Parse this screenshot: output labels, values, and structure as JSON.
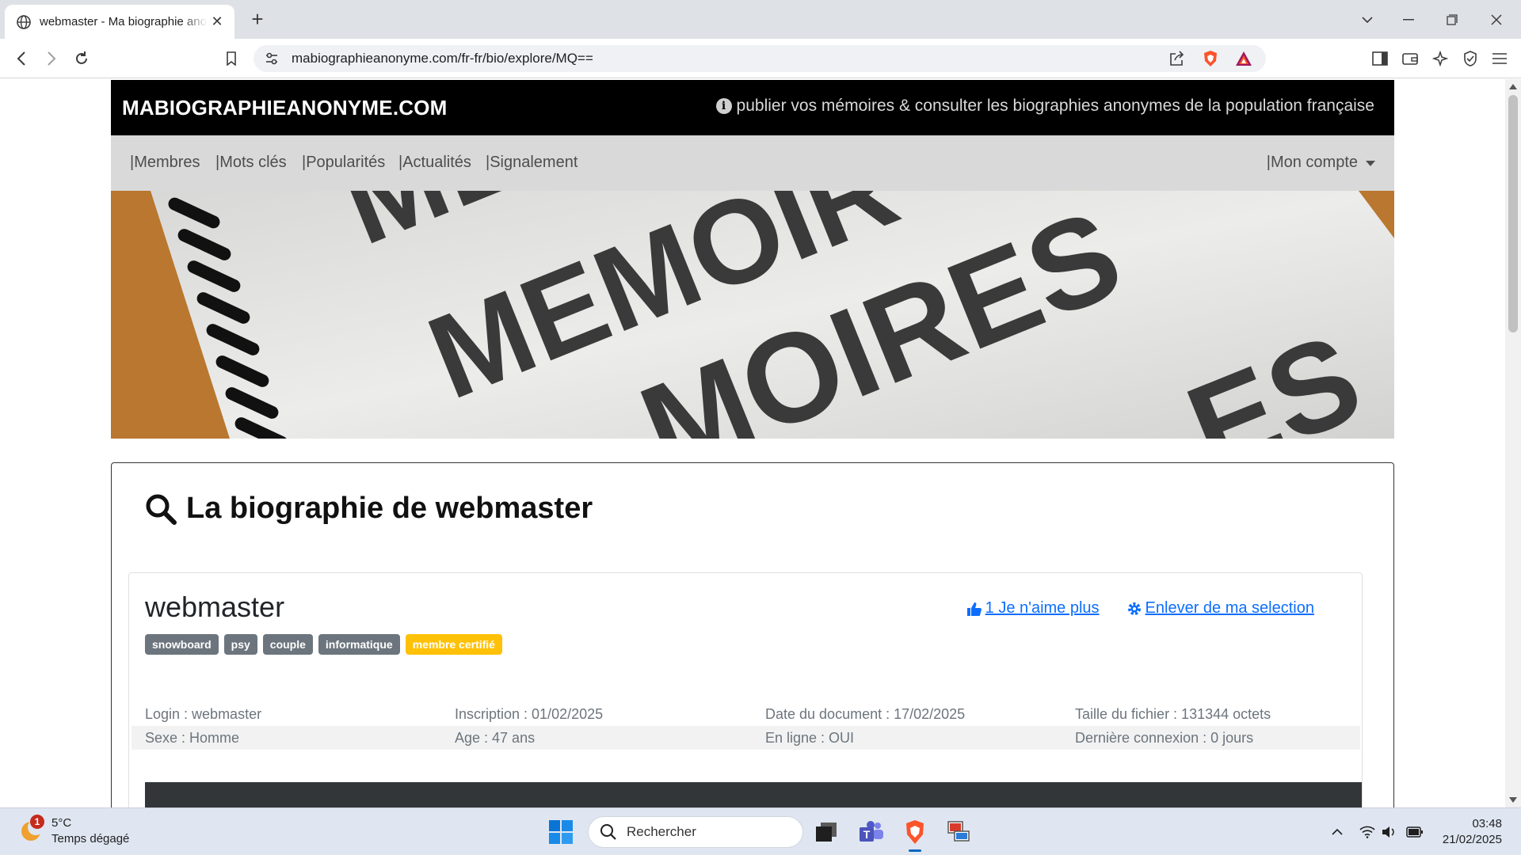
{
  "browser": {
    "tab_title": "webmaster - Ma biographie anonyme",
    "url": "mabiographieanonyme.com/fr-fr/bio/explore/MQ=="
  },
  "site": {
    "brand": "MABIOGRAPHIEANONYME.COM",
    "tagline": "publier vos mémoires & consulter les biographies anonymes de la population française",
    "nav": [
      "|Membres",
      "|Mots clés",
      "|Popularités",
      "|Actualités",
      "|Signalement"
    ],
    "account": "|Mon compte",
    "banner_words": [
      "ME",
      "MEMOIR",
      "MOIRES",
      "ES"
    ]
  },
  "page": {
    "title": "La biographie de webmaster",
    "username": "webmaster",
    "like_label": "1 Je n'aime plus",
    "selection_label": "Enlever de ma selection",
    "tags": [
      "snowboard",
      "psy",
      "couple",
      "informatique"
    ],
    "certified_label": "membre certifié",
    "info": {
      "login": "Login : webmaster",
      "inscription": "Inscription : 01/02/2025",
      "date_doc": "Date du document : 17/02/2025",
      "taille": "Taille du fichier : 131344 octets",
      "sexe": "Sexe : Homme",
      "age": "Age : 47 ans",
      "en_ligne": "En ligne : OUI",
      "derniere": "Dernière connexion : 0 jours"
    }
  },
  "taskbar": {
    "weather_temp": "5°C",
    "weather_desc": "Temps dégagé",
    "weather_badge": "1",
    "search_label": "Rechercher",
    "time": "03:48",
    "date": "21/02/2025"
  },
  "colors": {
    "link": "#0d6efd",
    "badge_gray": "#6c757d",
    "badge_certified": "#ffc107",
    "header_bg": "#000000",
    "nav_bg": "#d9d9d9"
  }
}
